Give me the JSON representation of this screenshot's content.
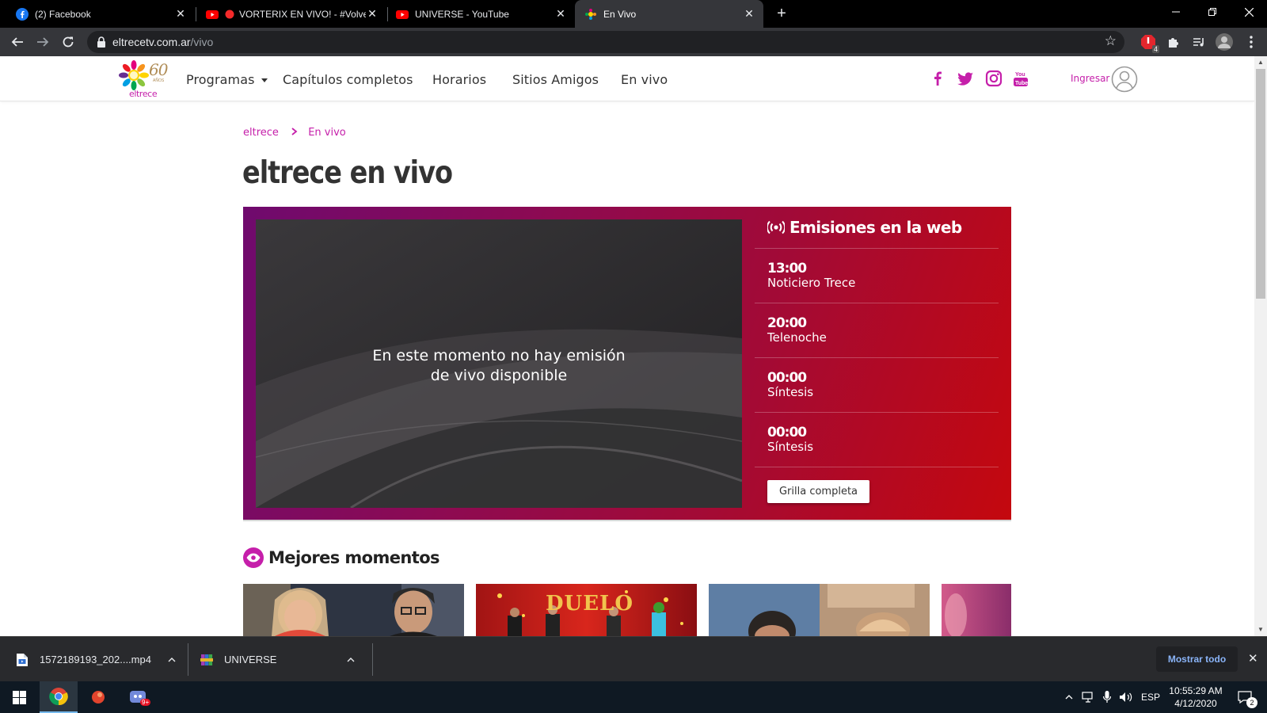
{
  "browser": {
    "tabs": [
      {
        "title": "(2) Facebook",
        "icon": "facebook-icon"
      },
      {
        "title": "VORTERIX EN VIVO! - #Volvet",
        "icon": "youtube-icon"
      },
      {
        "title": "UNIVERSE - YouTube",
        "icon": "youtube-icon"
      },
      {
        "title": "En Vivo",
        "icon": "eltrece-icon"
      }
    ],
    "new_tab": "+",
    "close": "✕",
    "url_host": "eltrecetv.com.ar",
    "url_path": "/vivo",
    "extension_badge": "4"
  },
  "site": {
    "logo_years": "60",
    "logo_anios": "AÑOS",
    "logo_name": "eltrece",
    "nav": [
      "Programas",
      "Capítulos completos",
      "Horarios",
      "Sitios Amigos",
      "En vivo"
    ],
    "login": "Ingresar"
  },
  "breadcrumb": {
    "home": "eltrece",
    "current": "En vivo"
  },
  "page_title": "eltrece en vivo",
  "player": {
    "line1": "En este momento no hay emisión",
    "line2": "de vivo disponible"
  },
  "schedule": {
    "title": "Emisiones en la web",
    "items": [
      {
        "time": "13:00",
        "program": "Noticiero Trece"
      },
      {
        "time": "20:00",
        "program": "Telenoche"
      },
      {
        "time": "00:00",
        "program": "Síntesis"
      },
      {
        "time": "00:00",
        "program": "Síntesis"
      }
    ],
    "button": "Grilla completa"
  },
  "moments": {
    "title": "Mejores momentos",
    "thumb_text": "DUELO"
  },
  "downloads": {
    "items": [
      {
        "name": "1572189193_202....mp4"
      },
      {
        "name": "UNIVERSE"
      }
    ],
    "show_all": "Mostrar todo",
    "close": "✕"
  },
  "taskbar": {
    "chrome_badge": "9+",
    "lang": "ESP",
    "time": "10:55:29 AM",
    "date": "4/12/2020",
    "notif_count": "2"
  },
  "colors": {
    "brand": "#c51faa",
    "panel_start": "#6f0a6e",
    "panel_end": "#c4080e"
  }
}
